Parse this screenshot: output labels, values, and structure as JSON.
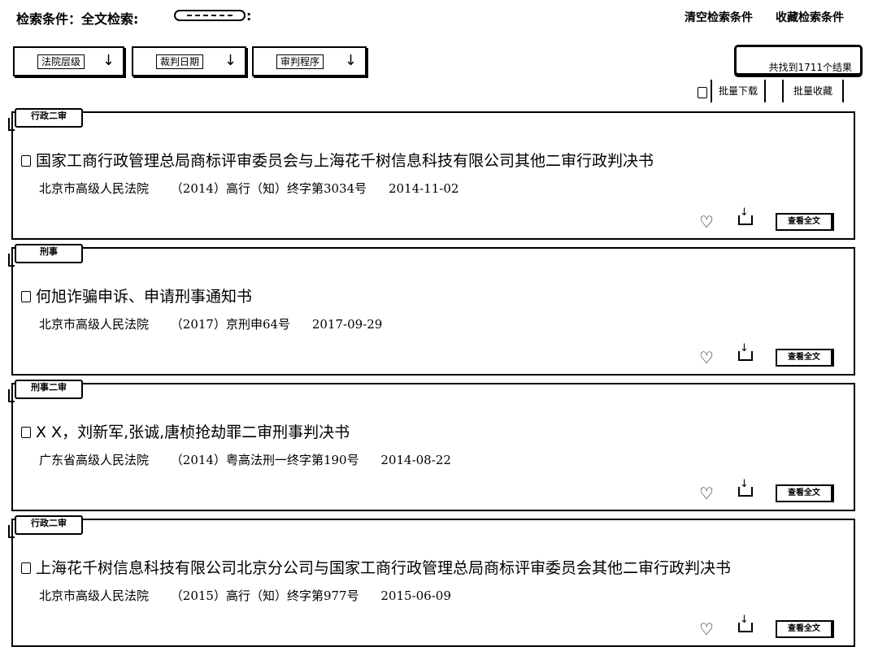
{
  "search": {
    "condition_label": "检索条件：全文检索:",
    "clear_label": "清空检索条件",
    "save_label": "收藏检索条件"
  },
  "sort_buttons": [
    {
      "label": "法院层级",
      "arrow": "↓"
    },
    {
      "label": "裁判日期",
      "arrow": "↓"
    },
    {
      "label": "审判程序",
      "arrow": "↓"
    }
  ],
  "result_count": "共找到1711个结果",
  "batch": {
    "download_label": "批量下载",
    "favorite_label": "批量收藏"
  },
  "results": [
    {
      "tag": "行政二审",
      "title": "国家工商行政管理总局商标评审委员会与上海花千树信息科技有限公司其他二审行政判决书",
      "court": "北京市高级人民法院",
      "case_number": "（2014）高行（知）终字第3034号",
      "date": "2014-11-02",
      "detail_label": "查看全文"
    },
    {
      "tag": "刑事",
      "title": "何旭诈骗申诉、申请刑事通知书",
      "court": "北京市高级人民法院",
      "case_number": "（2017）京刑申64号",
      "date": "2017-09-29",
      "detail_label": "查看全文"
    },
    {
      "tag": "刑事二审",
      "title": "X X，刘新军,张诚,唐桢抢劫罪二审刑事判决书",
      "court": "广东省高级人民法院",
      "case_number": "（2014）粤高法刑一终字第190号",
      "date": "2014-08-22",
      "detail_label": "查看全文"
    },
    {
      "tag": "行政二审",
      "title": "上海花千树信息科技有限公司北京分公司与国家工商行政管理总局商标评审委员会其他二审行政判决书",
      "court": "北京市高级人民法院",
      "case_number": "（2015）高行（知）终字第977号",
      "date": "2015-06-09",
      "detail_label": "查看全文"
    }
  ]
}
